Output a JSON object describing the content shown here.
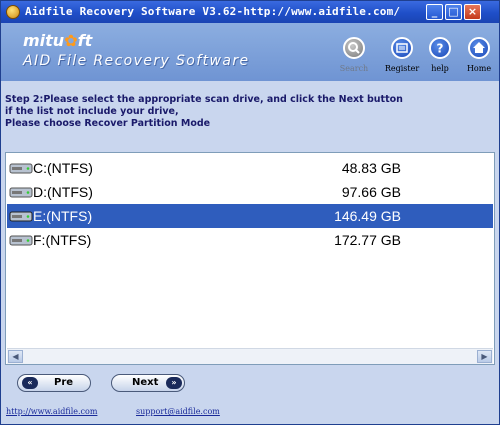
{
  "window": {
    "title": "Aidfile Recovery Software V3.62-http://www.aidfile.com/"
  },
  "header": {
    "logo_text_start": "mitu",
    "logo_text_mid": "s",
    "logo_text_end": "ft",
    "subtitle": "AID File Recovery Software",
    "toolbar": [
      {
        "label": "Search",
        "icon": "search-icon",
        "enabled": false
      },
      {
        "label": "Register",
        "icon": "register-icon",
        "enabled": true
      },
      {
        "label": "help",
        "icon": "help-icon",
        "enabled": true
      },
      {
        "label": "Home",
        "icon": "home-icon",
        "enabled": true
      }
    ]
  },
  "instructions": {
    "line1": "Step 2:Please select the appropriate scan drive, and click the Next button",
    "line2": " if the list not include your drive,",
    "line3": " Please choose Recover Partition Mode"
  },
  "drives": [
    {
      "name": "C:(NTFS)",
      "size": "48.83 GB",
      "selected": false
    },
    {
      "name": "D:(NTFS)",
      "size": "97.66 GB",
      "selected": false
    },
    {
      "name": "E:(NTFS)",
      "size": "146.49 GB",
      "selected": true
    },
    {
      "name": "F:(NTFS)",
      "size": "172.77 GB",
      "selected": false
    }
  ],
  "buttons": {
    "pre": "Pre",
    "next": "Next"
  },
  "footer": {
    "website": "http://www.aidfile.com",
    "email": "support@aidfile.com"
  },
  "colors": {
    "titlebar": "#1f4fc8",
    "selection": "#2f5dbd",
    "window_bg": "#c9d6ee",
    "header_bg": "#7a9dd8"
  }
}
